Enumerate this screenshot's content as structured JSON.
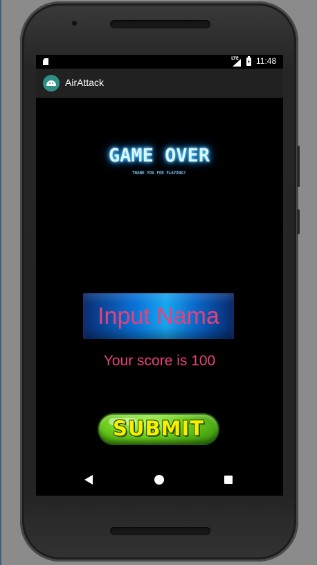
{
  "status_bar": {
    "network_label": "LTE",
    "time": "11:48",
    "icons": [
      "sd-card-icon",
      "signal-icon",
      "battery-icon"
    ]
  },
  "app_bar": {
    "title": "AirAttack",
    "icon": "android-app-icon",
    "color": "#212121"
  },
  "game_over": {
    "title": "GAME OVER",
    "subtitle": "THANK YOU FOR PLAYING?"
  },
  "name_input": {
    "placeholder": "Input Nama",
    "value": ""
  },
  "score": {
    "text": "Your score is 100"
  },
  "submit": {
    "label": "SUBMIT"
  },
  "nav_bar": {
    "icons": [
      "back-icon",
      "home-icon",
      "recents-icon"
    ]
  },
  "colors": {
    "accent_pink": "#e8417a",
    "submit_green": "#6fd01c",
    "submit_text_yellow": "#f7f000",
    "glow_blue": "#5fd4ff"
  }
}
